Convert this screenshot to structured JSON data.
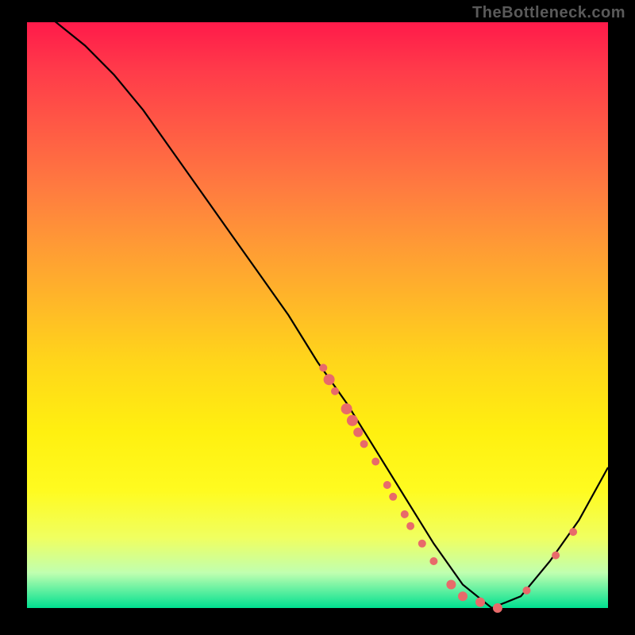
{
  "watermark": "TheBottleneck.com",
  "chart_data": {
    "type": "line",
    "title": "",
    "xlabel": "",
    "ylabel": "",
    "xlim": [
      0,
      100
    ],
    "ylim": [
      0,
      100
    ],
    "series": [
      {
        "name": "bottleneck-curve",
        "x": [
          0,
          5,
          10,
          15,
          20,
          25,
          30,
          35,
          40,
          45,
          50,
          55,
          60,
          65,
          70,
          75,
          80,
          85,
          90,
          95,
          100
        ],
        "values": [
          104,
          100,
          96,
          91,
          85,
          78,
          71,
          64,
          57,
          50,
          42,
          35,
          27,
          19,
          11,
          4,
          0,
          2,
          8,
          15,
          24
        ]
      }
    ],
    "markers": {
      "name": "highlighted-points",
      "color": "#e86a6a",
      "points": [
        {
          "x": 51,
          "y": 41,
          "r": 5
        },
        {
          "x": 52,
          "y": 39,
          "r": 7
        },
        {
          "x": 53,
          "y": 37,
          "r": 5
        },
        {
          "x": 55,
          "y": 34,
          "r": 7
        },
        {
          "x": 56,
          "y": 32,
          "r": 7
        },
        {
          "x": 57,
          "y": 30,
          "r": 6
        },
        {
          "x": 58,
          "y": 28,
          "r": 5
        },
        {
          "x": 60,
          "y": 25,
          "r": 5
        },
        {
          "x": 62,
          "y": 21,
          "r": 5
        },
        {
          "x": 63,
          "y": 19,
          "r": 5
        },
        {
          "x": 65,
          "y": 16,
          "r": 5
        },
        {
          "x": 66,
          "y": 14,
          "r": 5
        },
        {
          "x": 68,
          "y": 11,
          "r": 5
        },
        {
          "x": 70,
          "y": 8,
          "r": 5
        },
        {
          "x": 73,
          "y": 4,
          "r": 6
        },
        {
          "x": 75,
          "y": 2,
          "r": 6
        },
        {
          "x": 78,
          "y": 1,
          "r": 6
        },
        {
          "x": 81,
          "y": 0,
          "r": 6
        },
        {
          "x": 86,
          "y": 3,
          "r": 5
        },
        {
          "x": 91,
          "y": 9,
          "r": 5
        },
        {
          "x": 94,
          "y": 13,
          "r": 5
        }
      ]
    }
  }
}
